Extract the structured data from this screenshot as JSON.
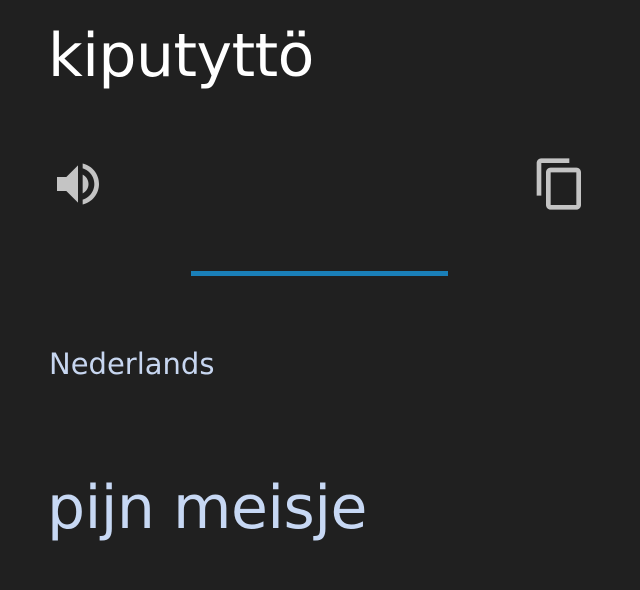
{
  "source": {
    "text": "kiputyttö",
    "speak_icon": "volume-up-icon",
    "copy_icon": "copy-icon"
  },
  "target": {
    "language": "Nederlands",
    "text": "pijn meisje"
  },
  "colors": {
    "background": "#202020",
    "source_text": "#ffffff",
    "icon": "#c4c4c4",
    "divider": "#1a7fb8",
    "target_language": "#c7d6f0",
    "target_text": "#c7d8f4"
  }
}
